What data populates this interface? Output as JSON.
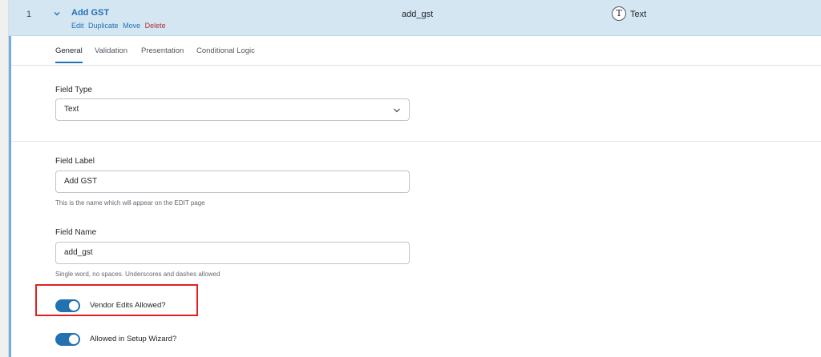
{
  "field": {
    "order": "1",
    "title": "Add GST",
    "actions": {
      "edit": "Edit",
      "duplicate": "Duplicate",
      "move": "Move",
      "delete": "Delete"
    },
    "name": "add_gst",
    "type_icon": "T",
    "type": "Text"
  },
  "tabs": [
    "General",
    "Validation",
    "Presentation",
    "Conditional Logic"
  ],
  "active_tab": "General",
  "form": {
    "field_type": {
      "label": "Field Type",
      "value": "Text"
    },
    "field_label": {
      "label": "Field Label",
      "value": "Add GST",
      "help": "This is the name which will appear on the EDIT page"
    },
    "field_name": {
      "label": "Field Name",
      "value": "add_gst",
      "help": "Single word, no spaces. Underscores and dashes allowed"
    },
    "vendor_edits": {
      "label": "Vendor Edits Allowed?",
      "on": true
    },
    "setup_wizard": {
      "label": "Allowed in Setup Wizard?",
      "on": true
    }
  },
  "colors": {
    "accent": "#2271b1",
    "header_bg": "#d5e6f3",
    "highlight": "#e02020"
  }
}
